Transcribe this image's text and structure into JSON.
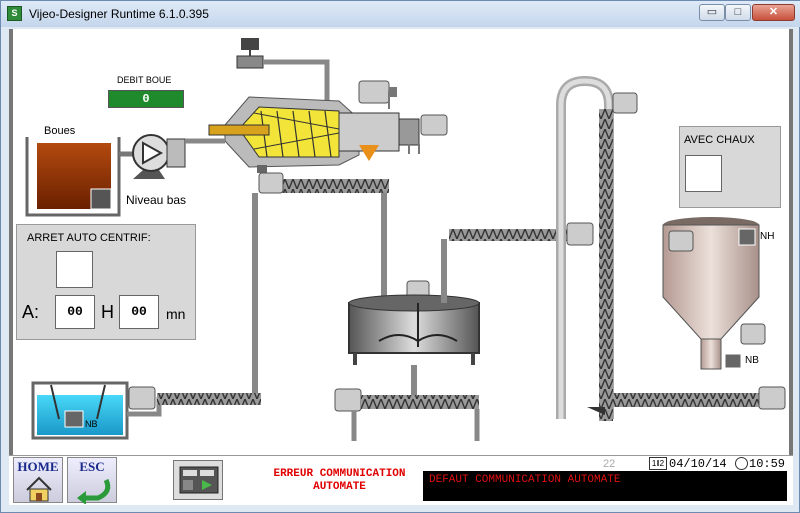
{
  "window": {
    "title": "Vijeo-Designer Runtime 6.1.0.395",
    "minimize": "▭",
    "maximize": "□",
    "close": "✕"
  },
  "debit": {
    "label": "DEBIT BOUE",
    "value": "0"
  },
  "labels": {
    "boues": "Boues",
    "niveau_bas": "Niveau bas",
    "nh": "NH",
    "nb": "NB",
    "nb_small": "NB"
  },
  "arret": {
    "title": "ARRET AUTO CENTRIF:",
    "a_label": "A:",
    "a_value": "00",
    "h_label": "H",
    "h_value": "00",
    "mn_label": "mn"
  },
  "chaux": {
    "title": "AVEC CHAUX"
  },
  "bottom": {
    "home": "HOME",
    "esc": "ESC",
    "error_line1": "ERREUR COMMUNICATION",
    "error_line2": "AUTOMATE",
    "counter": "22",
    "date": "04/10/14",
    "time": "10:59",
    "alarm": "DEFAUT COMMUNICATION AUTOMATE"
  },
  "colors": {
    "debit_bg": "#1f8a2c",
    "error_text": "#e00000",
    "alarm_bg": "#000000"
  }
}
